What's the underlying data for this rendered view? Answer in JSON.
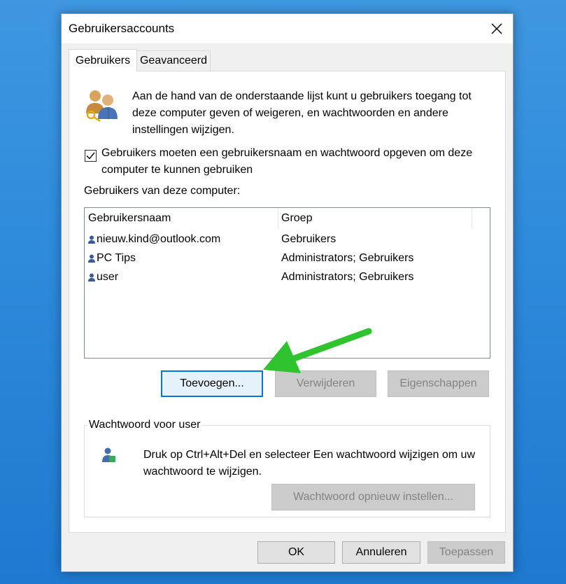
{
  "window": {
    "title": "Gebruikersaccounts"
  },
  "tabs": [
    {
      "label": "Gebruikers",
      "active": true
    },
    {
      "label": "Geavanceerd",
      "active": false
    }
  ],
  "intro": {
    "text": "Aan de hand van de onderstaande lijst kunt u gebruikers toegang tot deze computer geven of weigeren, en wachtwoorden en andere instellingen wijzigen."
  },
  "require_login": {
    "checked": true,
    "label": "Gebruikers moeten een gebruikersnaam en wachtwoord opgeven om deze computer te kunnen gebruiken"
  },
  "users_list": {
    "heading": "Gebruikers van deze computer:",
    "columns": [
      "Gebruikersnaam",
      "Groep"
    ],
    "rows": [
      {
        "name": "nieuw.kind@outlook.com",
        "group": "Gebruikers"
      },
      {
        "name": "PC Tips",
        "group": "Administrators; Gebruikers"
      },
      {
        "name": "user",
        "group": "Administrators; Gebruikers"
      }
    ]
  },
  "list_buttons": {
    "add": "Toevoegen...",
    "remove": "Verwijderen",
    "properties": "Eigenschappen"
  },
  "password_group": {
    "label": "Wachtwoord voor user",
    "text": "Druk op Ctrl+Alt+Del en selecteer Een wachtwoord wijzigen om uw wachtwoord te wijzigen.",
    "reset_button": "Wachtwoord opnieuw instellen..."
  },
  "footer": {
    "ok": "OK",
    "cancel": "Annuleren",
    "apply": "Toepassen"
  },
  "colors": {
    "accent": "#0078d7",
    "arrow": "#2fc42f",
    "desktop": "#2f8bdc"
  }
}
